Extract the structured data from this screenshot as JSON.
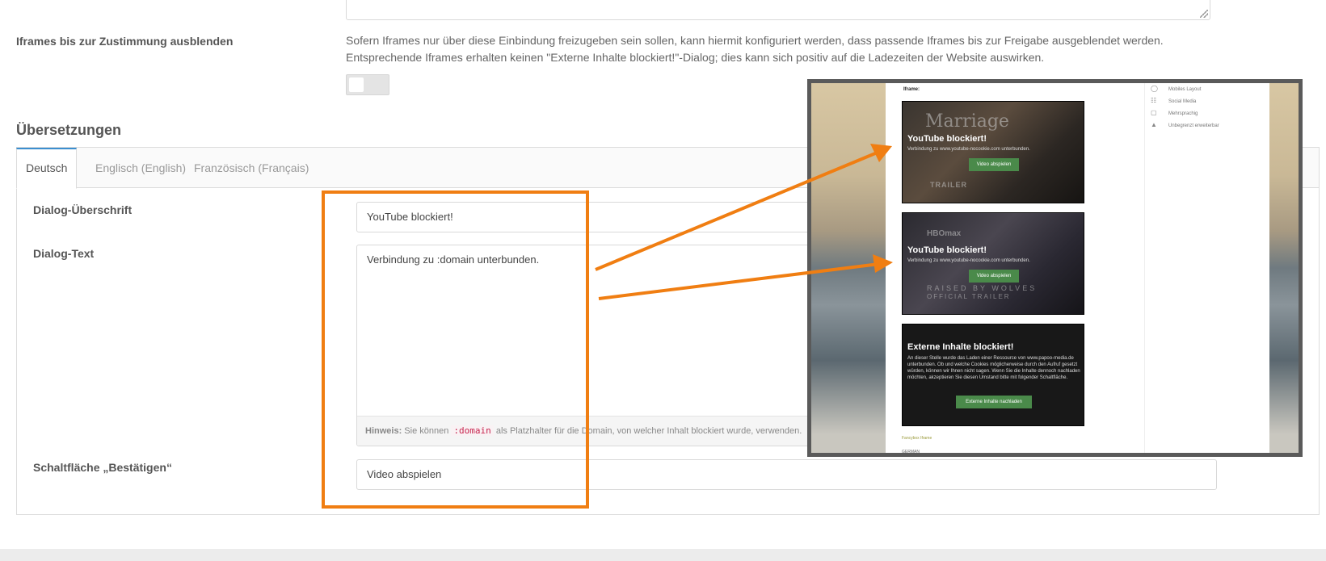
{
  "settings": {
    "iframes_hide": {
      "label": "Iframes bis zur Zustimmung ausblenden",
      "description_line1": "Sofern Iframes nur über diese Einbindung freizugeben sein sollen, kann hiermit konfiguriert werden, dass passende Iframes bis zur Freigabe ausgeblendet werden.",
      "description_line2": "Entsprechende Iframes erhalten keinen \"Externe Inhalte blockiert!\"-Dialog; dies kann sich positiv auf die Ladezeiten der Website auswirken.",
      "enabled": false
    }
  },
  "translations": {
    "title": "Übersetzungen",
    "tabs": [
      {
        "label": "Deutsch",
        "active": true
      },
      {
        "label": "Englisch (English)",
        "active": false
      },
      {
        "label": "Französisch (Français)",
        "active": false
      }
    ],
    "fields": {
      "dialog_heading": {
        "label": "Dialog-Überschrift",
        "value": "YouTube blockiert!"
      },
      "dialog_text": {
        "label": "Dialog-Text",
        "value": "Verbindung zu :domain unterbunden."
      },
      "hint": {
        "prefix": "Hinweis:",
        "text_before": "Sie können",
        "code": ":domain",
        "text_after": "als Platzhalter für die Domain, von welcher Inhalt blockiert wurde, verwenden."
      },
      "confirm_button": {
        "label": "Schaltfläche „Bestätigen“",
        "value": "Video abspielen"
      }
    }
  },
  "preview": {
    "iframe_label": "Iframe:",
    "block1": {
      "heading": "YouTube blockiert!",
      "text": "Verbindung zu www.youtube-nocookie.com unterbunden.",
      "button": "Video abspielen",
      "bg_title": "Marriage",
      "bg_sub": "TRAILER"
    },
    "block2": {
      "heading": "YouTube blockiert!",
      "text": "Verbindung zu www.youtube-nocookie.com unterbunden.",
      "button": "Video abspielen",
      "bg_logo": "HBOmax",
      "bg_title": "RAISED BY WOLVES",
      "bg_sub": "OFFICIAL TRAILER"
    },
    "block3": {
      "heading": "Externe Inhalte blockiert!",
      "text": "An dieser Stelle wurde das Laden einer Ressource von www.papoo-media.de unterbunden. Ob und welche Cookies möglicherweise durch den Aufruf gesetzt würden, können wir Ihnen nicht sagen. Wenn Sie die Inhalte dennoch nachladen möchten, akzeptieren Sie diesen Umstand bitte mit folgender Schaltfläche.",
      "button": "Externe Inhalte nachladen"
    },
    "link1": "Fancybox Iframe",
    "link2": "GERMAN",
    "sidebar": [
      {
        "icon": "globe-icon",
        "label": "Mobiles Layout"
      },
      {
        "icon": "social-icon",
        "label": "Social Media"
      },
      {
        "icon": "car-icon",
        "label": "Mehrsprachig"
      },
      {
        "icon": "graduation-icon",
        "label": "Unbegrenzt erweiterbar"
      }
    ]
  },
  "colors": {
    "annotation_orange": "#f07e12",
    "tab_accent": "#3b8fd0",
    "preview_button_green": "#4a8a4a"
  }
}
